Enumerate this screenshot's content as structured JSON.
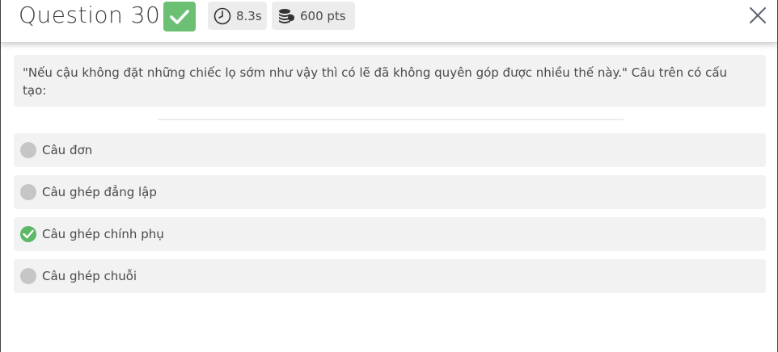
{
  "header": {
    "title": "Question 30",
    "time": "8.3s",
    "points": "600 pts"
  },
  "question": {
    "text": "\"Nếu cậu không đặt những chiếc lọ sớm như vậy thì có lẽ đã không quyên góp được nhiều thế này.\" Câu trên có cấu tạo:"
  },
  "options": [
    {
      "label": "Câu đơn",
      "state": "neutral"
    },
    {
      "label": "Câu ghép đẳng lập",
      "state": "neutral"
    },
    {
      "label": "Câu ghép chính phụ",
      "state": "correct"
    },
    {
      "label": "Câu ghép chuỗi",
      "state": "neutral"
    }
  ],
  "colors": {
    "correct": "#6cc073",
    "neutral_radio": "#c6c6c6",
    "card_bg": "#f2f2f2"
  },
  "icons": {
    "status": "check-icon",
    "time": "clock-icon",
    "points": "coins-icon",
    "close": "close-icon"
  }
}
